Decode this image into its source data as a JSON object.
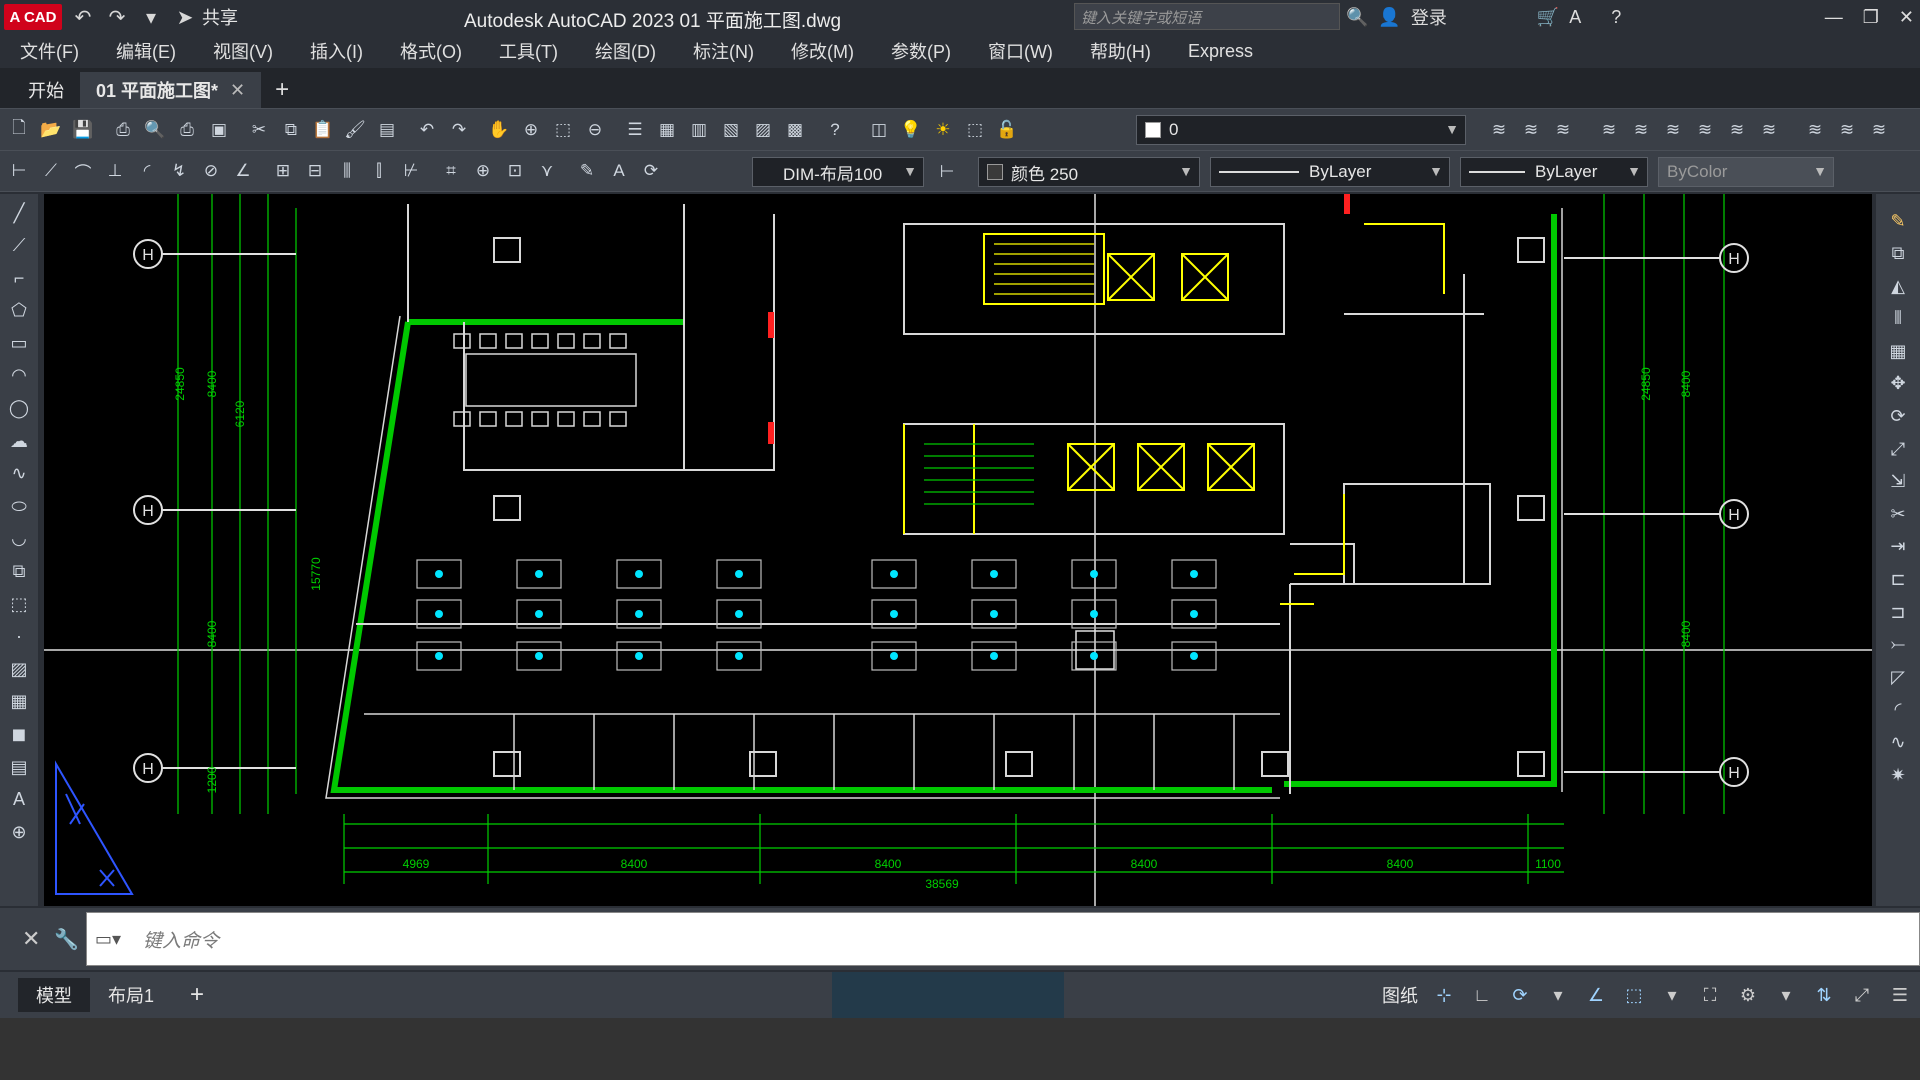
{
  "titlebar": {
    "logo": "A CAD",
    "share": "共享",
    "title": "Autodesk AutoCAD 2023    01  平面施工图.dwg",
    "search_placeholder": "键入关键字或短语",
    "login": "登录"
  },
  "menu": [
    "文件(F)",
    "编辑(E)",
    "视图(V)",
    "插入(I)",
    "格式(O)",
    "工具(T)",
    "绘图(D)",
    "标注(N)",
    "修改(M)",
    "参数(P)",
    "窗口(W)",
    "帮助(H)",
    "Express"
  ],
  "tabs": {
    "start": "开始",
    "doc": "01  平面施工图*",
    "close": "✕",
    "add": "+"
  },
  "toolbar": {
    "layer_value": "0",
    "dimstyle": "DIM-布局100",
    "color": "颜色 250",
    "color_hex": "#3a3a3a",
    "linetype": "ByLayer",
    "lineweight": "ByLayer",
    "plotstyle": "ByColor"
  },
  "drawing": {
    "grid_bubble": "H",
    "dims_bottom": [
      "4969",
      "8400",
      "8400",
      "8400",
      "8400",
      "1100",
      "38569"
    ],
    "dims_left": [
      "24850",
      "8400",
      "6120",
      "15770",
      "8400",
      "1200"
    ],
    "dims_right": [
      "24850",
      "8400",
      "8400"
    ],
    "colors": {
      "wall": "#00c800",
      "outline": "#d8d8d8",
      "accent": "#ffff00",
      "furniture": "#00e5ff",
      "dim": "#00d000"
    }
  },
  "command": {
    "placeholder": "键入命令"
  },
  "status": {
    "model": "模型",
    "layout1": "布局1",
    "add": "+",
    "paper": "图纸"
  }
}
